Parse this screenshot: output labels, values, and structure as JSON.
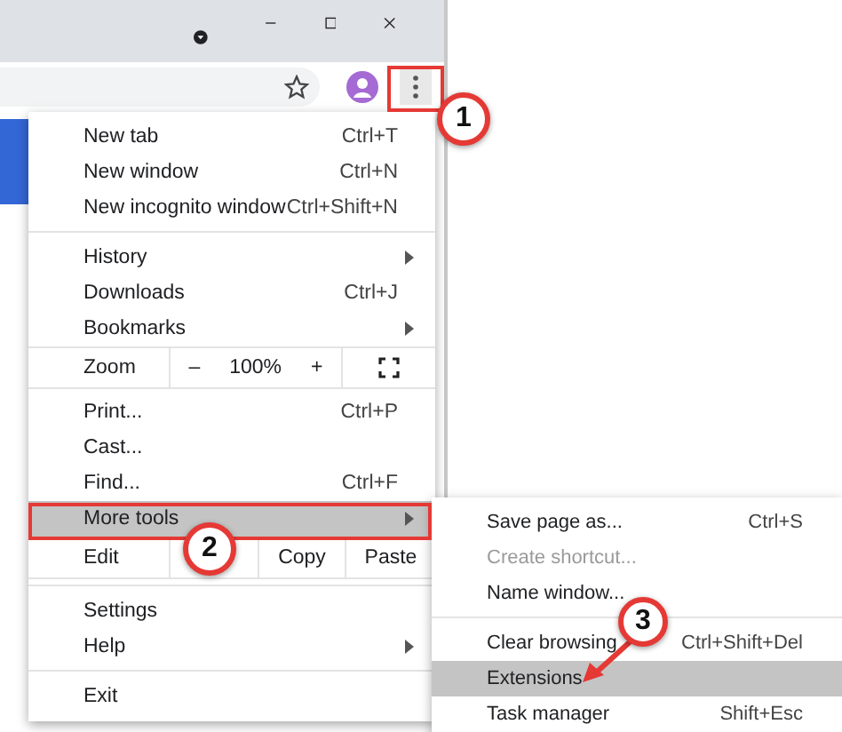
{
  "menu": {
    "items": [
      {
        "kind": "item",
        "label": "New tab",
        "shortcut": "Ctrl+T",
        "submenu": false,
        "selected": false
      },
      {
        "kind": "item",
        "label": "New window",
        "shortcut": "Ctrl+N",
        "submenu": false,
        "selected": false
      },
      {
        "kind": "item",
        "label": "New incognito window",
        "shortcut": "Ctrl+Shift+N",
        "submenu": false,
        "selected": false
      },
      {
        "kind": "separator"
      },
      {
        "kind": "item",
        "label": "History",
        "submenu": true,
        "selected": false
      },
      {
        "kind": "item",
        "label": "Downloads",
        "shortcut": "Ctrl+J",
        "submenu": false,
        "selected": false
      },
      {
        "kind": "item",
        "label": "Bookmarks",
        "submenu": true,
        "selected": false
      },
      {
        "kind": "zoom",
        "label": "Zoom",
        "minus": "–",
        "value": "100%",
        "plus": "+"
      },
      {
        "kind": "item",
        "label": "Print...",
        "shortcut": "Ctrl+P",
        "submenu": false,
        "selected": false
      },
      {
        "kind": "item",
        "label": "Cast...",
        "submenu": false,
        "selected": false
      },
      {
        "kind": "item",
        "label": "Find...",
        "shortcut": "Ctrl+F",
        "submenu": false,
        "selected": false
      },
      {
        "kind": "item",
        "label": "More tools",
        "submenu": true,
        "selected": true
      },
      {
        "kind": "edit",
        "label": "Edit",
        "buttons": [
          "Copy",
          "Paste"
        ]
      },
      {
        "kind": "separator"
      },
      {
        "kind": "item",
        "label": "Settings",
        "submenu": false,
        "selected": false
      },
      {
        "kind": "item",
        "label": "Help",
        "submenu": true,
        "selected": false
      },
      {
        "kind": "separator"
      },
      {
        "kind": "item",
        "label": "Exit",
        "submenu": false,
        "selected": false
      }
    ]
  },
  "submenu": {
    "items": [
      {
        "kind": "item",
        "label": "Save page as...",
        "shortcut": "Ctrl+S",
        "disabled": false,
        "selected": false
      },
      {
        "kind": "item",
        "label": "Create shortcut...",
        "disabled": true,
        "selected": false
      },
      {
        "kind": "item",
        "label": "Name window...",
        "disabled": false,
        "selected": false
      },
      {
        "kind": "separator"
      },
      {
        "kind": "item",
        "label": "Clear browsing",
        "shortcut": "Ctrl+Shift+Del",
        "disabled": false,
        "selected": false
      },
      {
        "kind": "item",
        "label": "Extensions",
        "disabled": false,
        "selected": true
      },
      {
        "kind": "item",
        "label": "Task manager",
        "shortcut": "Shift+Esc",
        "disabled": false,
        "selected": false
      }
    ]
  },
  "callouts": [
    "1",
    "2",
    "3"
  ]
}
